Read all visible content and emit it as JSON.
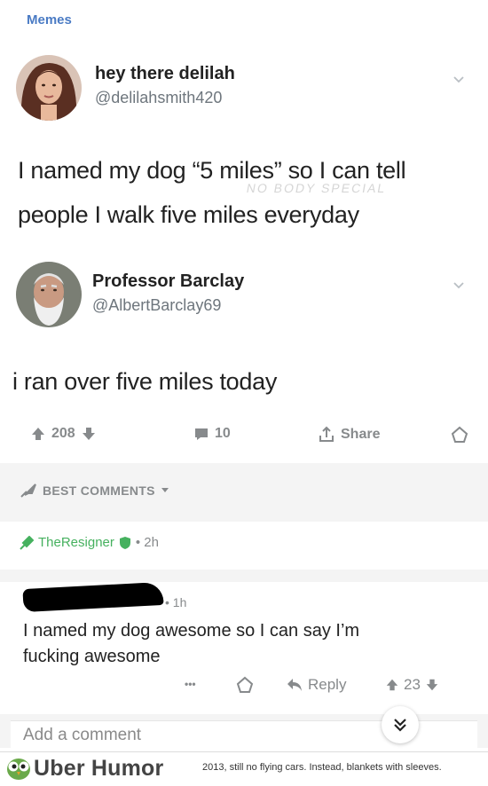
{
  "subreddit": "Memes",
  "tweet1": {
    "name": "hey there delilah",
    "handle": "@delilahsmith420",
    "text_line1": "I named my dog “5 miles” so I can tell",
    "text_line2": "people I walk five miles everyday",
    "watermark": "NO BODY  SPECIAL"
  },
  "tweet2": {
    "name": "Professor Barclay",
    "handle": "@AlbertBarclay69",
    "text": "i ran over five miles today"
  },
  "actions": {
    "upvotes": "208",
    "comments": "10",
    "share": "Share"
  },
  "comments_section": {
    "sort_label": "BEST COMMENTS",
    "comment1": {
      "author": "TheResigner",
      "time": "• 2h"
    },
    "comment2": {
      "time": "• 1h",
      "body_line1": "I named my dog awesome so I can say I’m",
      "body_line2": "fucking awesome",
      "more": "•••",
      "reply": "Reply",
      "votes": "23"
    },
    "add_placeholder": "Add a comment"
  },
  "footer": {
    "brand": "Uber Humor",
    "tagline": "2013, still no flying cars. Instead, blankets with sleeves."
  },
  "colors": {
    "subreddit": "#4a7bc4",
    "author_green": "#46b15f",
    "muted": "#878a8c"
  }
}
